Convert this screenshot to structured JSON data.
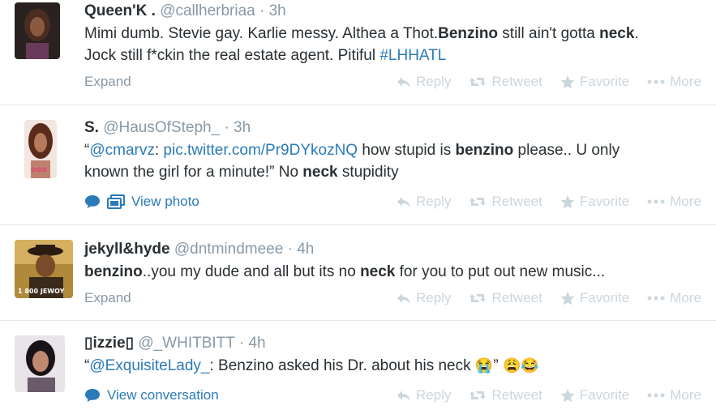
{
  "actions": {
    "reply": "Reply",
    "retweet": "Retweet",
    "favorite": "Favorite",
    "more": "More"
  },
  "colors": {
    "link": "#2b7bb9",
    "muted": "#8899a6",
    "action_gray": "#ccd6dd",
    "divider": "#e1e8ed"
  },
  "tweets": [
    {
      "fullname": "Queen'K .",
      "handle": "@callherbriaa",
      "dot": "·",
      "time": "3h",
      "text_1": "Mimi dumb. Stevie gay. Karlie messy. Althea a Thot.",
      "bold_1": "Benzino",
      "text_2": " still ain't gotta ",
      "bold_2": "neck",
      "text_3": ".",
      "text_4": "Jock still f*ckin the real estate agent. Pitiful ",
      "hashtag": "#LHHATL",
      "footer_label": "Expand"
    },
    {
      "fullname": "S.",
      "handle": "@HausOfSteph_",
      "dot": "·",
      "time": "3h",
      "open_quote": "“",
      "mention": "@cmarvz",
      "colon": ": ",
      "pic_link": "pic.twitter.com/Pr9DYkozNQ",
      "text_1": " how stupid is ",
      "bold_1": "benzino",
      "text_2": " please.. U only",
      "text_3": "known the girl for a minute!” No ",
      "bold_2": "neck",
      "text_4": " stupidity",
      "footer_label": "View photo",
      "footer_icons": [
        "speech-bubble-icon",
        "photo-icon"
      ]
    },
    {
      "fullname": "jekyll&hyde",
      "handle": "@dntmindmeee",
      "dot": "·",
      "time": "4h",
      "bold_1": "benzino",
      "text_1": "..you my dude and all but its no ",
      "bold_2": "neck",
      "text_2": " for you to put out new music...",
      "avatar_caption": "1 800 JEWOY",
      "footer_label": "Expand"
    },
    {
      "fullname": "▯izzie▯",
      "handle": "@_WHITBITT",
      "dot": "·",
      "time": "4h",
      "open_quote": "“",
      "mention": "@ExquisiteLady_",
      "text_1": ": Benzino asked his Dr. about his neck ",
      "emoji_1": "😭",
      "text_2": "” ",
      "emoji_2": "😩😂",
      "footer_label": "View conversation",
      "footer_icons": [
        "speech-bubble-icon"
      ]
    }
  ]
}
